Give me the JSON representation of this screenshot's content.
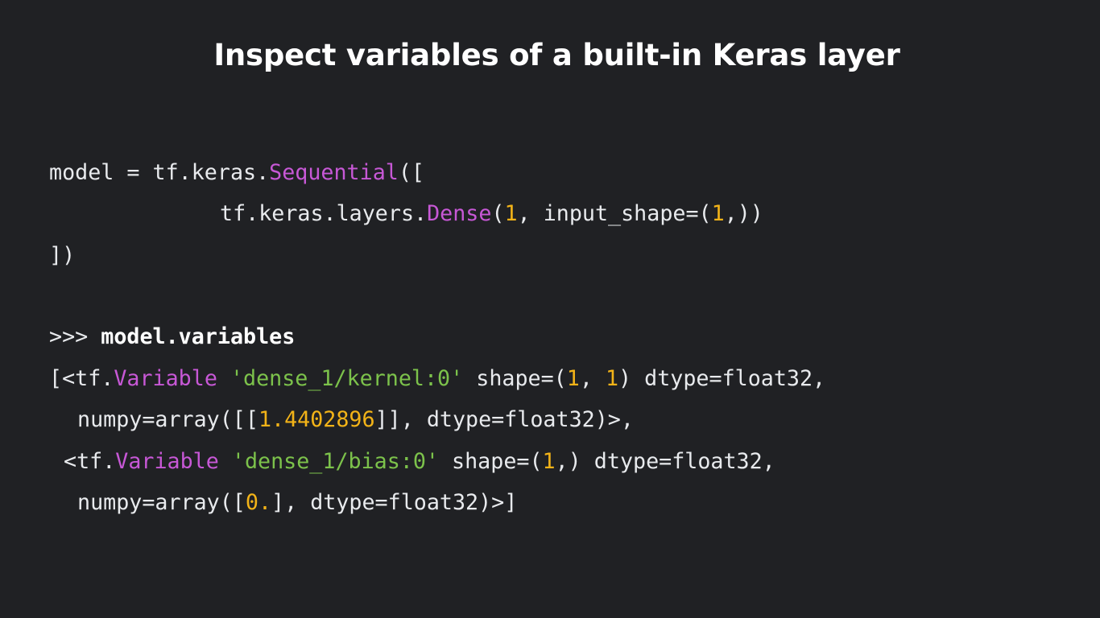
{
  "slide": {
    "title": "Inspect variables of a built-in Keras layer"
  },
  "code": {
    "line1": {
      "a": "model = tf.keras.",
      "b": "Sequential",
      "c": "(["
    },
    "line2": {
      "a": "tf.keras.layers.",
      "b": "Dense",
      "c": "(",
      "d": "1",
      "e": ", input_shape=(",
      "f": "1",
      "g": ",))"
    },
    "line3": {
      "a": "])"
    },
    "line4": {
      "a": ">>> ",
      "b": "model.variables"
    },
    "line5": {
      "a": "[<tf.",
      "b": "Variable",
      "c": " ",
      "d": "'dense_1/kernel:0'",
      "e": " shape=(",
      "f": "1",
      "g": ", ",
      "h": "1",
      "i": ") dtype=float32,"
    },
    "line6": {
      "a": "numpy=array([[",
      "b": "1.4402896",
      "c": "]], dtype=float32)>,"
    },
    "line7": {
      "a": "<tf.",
      "b": "Variable",
      "c": " ",
      "d": "'dense_1/bias:0'",
      "e": " shape=(",
      "f": "1",
      "g": ",) dtype=float32,"
    },
    "line8": {
      "a": "numpy=array([",
      "b": "0.",
      "c": "], dtype=float32)>]"
    }
  },
  "colors": {
    "background": "#202124",
    "text": "#e8eaed",
    "class_name": "#c758d6",
    "number": "#f2b318",
    "string": "#7cc24b"
  }
}
